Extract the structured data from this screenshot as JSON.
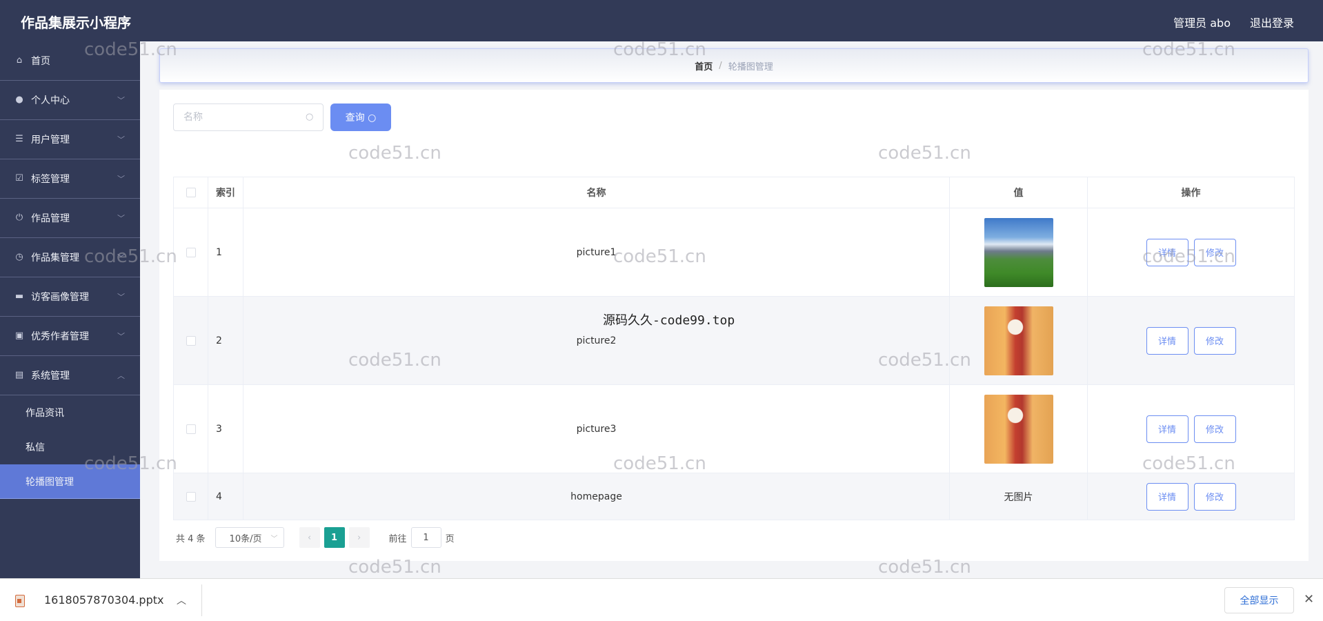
{
  "app": {
    "title": "作品集展示小程序"
  },
  "header": {
    "admin": "管理员 abo",
    "logout": "退出登录"
  },
  "sidebar": {
    "items": [
      {
        "label": "首页",
        "icon": "home-icon"
      },
      {
        "label": "个人中心",
        "icon": "user-icon"
      },
      {
        "label": "用户管理",
        "icon": "sliders-icon"
      },
      {
        "label": "标签管理",
        "icon": "tag-icon"
      },
      {
        "label": "作品管理",
        "icon": "power-icon"
      },
      {
        "label": "作品集管理",
        "icon": "clock-icon"
      },
      {
        "label": "访客画像管理",
        "icon": "ticket-icon"
      },
      {
        "label": "优秀作者管理",
        "icon": "briefcase-icon"
      },
      {
        "label": "系统管理",
        "icon": "server-icon"
      }
    ],
    "sub_items": [
      {
        "label": "作品资讯"
      },
      {
        "label": "私信"
      },
      {
        "label": "轮播图管理"
      }
    ]
  },
  "breadcrumb": {
    "home": "首页",
    "sep": "/",
    "current": "轮播图管理"
  },
  "search": {
    "placeholder": "名称",
    "value": "",
    "button": "查询"
  },
  "table": {
    "headers": {
      "index": "索引",
      "name": "名称",
      "value": "值",
      "ops": "操作"
    },
    "rows": [
      {
        "index": "1",
        "name": "picture1",
        "value": "",
        "image": "mountain-landscape"
      },
      {
        "index": "2",
        "name": "picture2",
        "value": "",
        "image": "toy-figure"
      },
      {
        "index": "3",
        "name": "picture3",
        "value": "",
        "image": "toy-figure"
      },
      {
        "index": "4",
        "name": "homepage",
        "value": "无图片",
        "image": ""
      }
    ],
    "detail_label": "详情",
    "edit_label": "修改"
  },
  "pagination": {
    "total": "共 4 条",
    "page_size": "10条/页",
    "current_page": "1",
    "goto": "前往",
    "goto_value": "1",
    "page_unit": "页"
  },
  "overlay_text": "源码久久-code99.top",
  "watermark": "code51.cn",
  "download_bar": {
    "file": "1618057870304.pptx",
    "show_all": "全部显示"
  }
}
